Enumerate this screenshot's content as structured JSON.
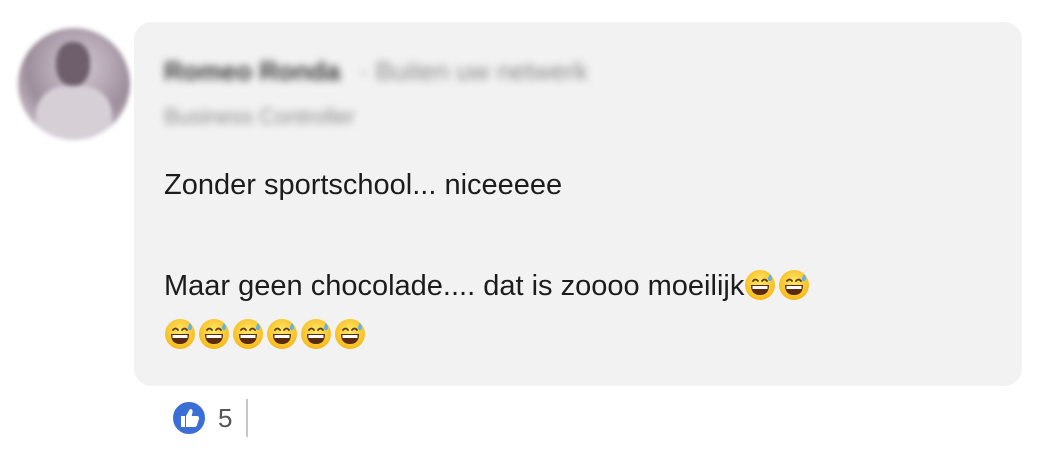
{
  "comment": {
    "author_name": "Romeo Ronda",
    "author_relation": "Buiten uw netwerk",
    "author_subtitle": "Business Controller",
    "line1": "Zonder sportschool... niceeeee",
    "line2": "Maar geen chocolade.... dat is zoooo moeilijk",
    "line2_emoji_count": 2,
    "line3_emoji_count": 6,
    "emoji_name": "grinning-face-with-sweat-emoji",
    "bubble_color": "#f2f2f2"
  },
  "reactions": {
    "icon": "thumbs-up-icon",
    "count": "5",
    "accent": "#3b6fd6"
  }
}
